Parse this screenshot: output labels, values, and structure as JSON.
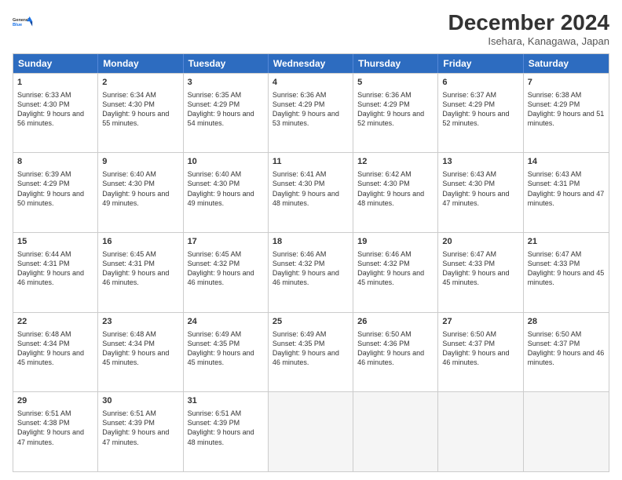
{
  "logo": {
    "line1": "General",
    "line2": "Blue",
    "icon_color": "#1a73e8"
  },
  "header": {
    "month": "December 2024",
    "location": "Isehara, Kanagawa, Japan"
  },
  "weekdays": [
    "Sunday",
    "Monday",
    "Tuesday",
    "Wednesday",
    "Thursday",
    "Friday",
    "Saturday"
  ],
  "weeks": [
    [
      {
        "day": "1",
        "sunrise": "Sunrise: 6:33 AM",
        "sunset": "Sunset: 4:30 PM",
        "daylight": "Daylight: 9 hours and 56 minutes."
      },
      {
        "day": "2",
        "sunrise": "Sunrise: 6:34 AM",
        "sunset": "Sunset: 4:30 PM",
        "daylight": "Daylight: 9 hours and 55 minutes."
      },
      {
        "day": "3",
        "sunrise": "Sunrise: 6:35 AM",
        "sunset": "Sunset: 4:29 PM",
        "daylight": "Daylight: 9 hours and 54 minutes."
      },
      {
        "day": "4",
        "sunrise": "Sunrise: 6:36 AM",
        "sunset": "Sunset: 4:29 PM",
        "daylight": "Daylight: 9 hours and 53 minutes."
      },
      {
        "day": "5",
        "sunrise": "Sunrise: 6:36 AM",
        "sunset": "Sunset: 4:29 PM",
        "daylight": "Daylight: 9 hours and 52 minutes."
      },
      {
        "day": "6",
        "sunrise": "Sunrise: 6:37 AM",
        "sunset": "Sunset: 4:29 PM",
        "daylight": "Daylight: 9 hours and 52 minutes."
      },
      {
        "day": "7",
        "sunrise": "Sunrise: 6:38 AM",
        "sunset": "Sunset: 4:29 PM",
        "daylight": "Daylight: 9 hours and 51 minutes."
      }
    ],
    [
      {
        "day": "8",
        "sunrise": "Sunrise: 6:39 AM",
        "sunset": "Sunset: 4:29 PM",
        "daylight": "Daylight: 9 hours and 50 minutes."
      },
      {
        "day": "9",
        "sunrise": "Sunrise: 6:40 AM",
        "sunset": "Sunset: 4:30 PM",
        "daylight": "Daylight: 9 hours and 49 minutes."
      },
      {
        "day": "10",
        "sunrise": "Sunrise: 6:40 AM",
        "sunset": "Sunset: 4:30 PM",
        "daylight": "Daylight: 9 hours and 49 minutes."
      },
      {
        "day": "11",
        "sunrise": "Sunrise: 6:41 AM",
        "sunset": "Sunset: 4:30 PM",
        "daylight": "Daylight: 9 hours and 48 minutes."
      },
      {
        "day": "12",
        "sunrise": "Sunrise: 6:42 AM",
        "sunset": "Sunset: 4:30 PM",
        "daylight": "Daylight: 9 hours and 48 minutes."
      },
      {
        "day": "13",
        "sunrise": "Sunrise: 6:43 AM",
        "sunset": "Sunset: 4:30 PM",
        "daylight": "Daylight: 9 hours and 47 minutes."
      },
      {
        "day": "14",
        "sunrise": "Sunrise: 6:43 AM",
        "sunset": "Sunset: 4:31 PM",
        "daylight": "Daylight: 9 hours and 47 minutes."
      }
    ],
    [
      {
        "day": "15",
        "sunrise": "Sunrise: 6:44 AM",
        "sunset": "Sunset: 4:31 PM",
        "daylight": "Daylight: 9 hours and 46 minutes."
      },
      {
        "day": "16",
        "sunrise": "Sunrise: 6:45 AM",
        "sunset": "Sunset: 4:31 PM",
        "daylight": "Daylight: 9 hours and 46 minutes."
      },
      {
        "day": "17",
        "sunrise": "Sunrise: 6:45 AM",
        "sunset": "Sunset: 4:32 PM",
        "daylight": "Daylight: 9 hours and 46 minutes."
      },
      {
        "day": "18",
        "sunrise": "Sunrise: 6:46 AM",
        "sunset": "Sunset: 4:32 PM",
        "daylight": "Daylight: 9 hours and 46 minutes."
      },
      {
        "day": "19",
        "sunrise": "Sunrise: 6:46 AM",
        "sunset": "Sunset: 4:32 PM",
        "daylight": "Daylight: 9 hours and 45 minutes."
      },
      {
        "day": "20",
        "sunrise": "Sunrise: 6:47 AM",
        "sunset": "Sunset: 4:33 PM",
        "daylight": "Daylight: 9 hours and 45 minutes."
      },
      {
        "day": "21",
        "sunrise": "Sunrise: 6:47 AM",
        "sunset": "Sunset: 4:33 PM",
        "daylight": "Daylight: 9 hours and 45 minutes."
      }
    ],
    [
      {
        "day": "22",
        "sunrise": "Sunrise: 6:48 AM",
        "sunset": "Sunset: 4:34 PM",
        "daylight": "Daylight: 9 hours and 45 minutes."
      },
      {
        "day": "23",
        "sunrise": "Sunrise: 6:48 AM",
        "sunset": "Sunset: 4:34 PM",
        "daylight": "Daylight: 9 hours and 45 minutes."
      },
      {
        "day": "24",
        "sunrise": "Sunrise: 6:49 AM",
        "sunset": "Sunset: 4:35 PM",
        "daylight": "Daylight: 9 hours and 45 minutes."
      },
      {
        "day": "25",
        "sunrise": "Sunrise: 6:49 AM",
        "sunset": "Sunset: 4:35 PM",
        "daylight": "Daylight: 9 hours and 46 minutes."
      },
      {
        "day": "26",
        "sunrise": "Sunrise: 6:50 AM",
        "sunset": "Sunset: 4:36 PM",
        "daylight": "Daylight: 9 hours and 46 minutes."
      },
      {
        "day": "27",
        "sunrise": "Sunrise: 6:50 AM",
        "sunset": "Sunset: 4:37 PM",
        "daylight": "Daylight: 9 hours and 46 minutes."
      },
      {
        "day": "28",
        "sunrise": "Sunrise: 6:50 AM",
        "sunset": "Sunset: 4:37 PM",
        "daylight": "Daylight: 9 hours and 46 minutes."
      }
    ],
    [
      {
        "day": "29",
        "sunrise": "Sunrise: 6:51 AM",
        "sunset": "Sunset: 4:38 PM",
        "daylight": "Daylight: 9 hours and 47 minutes."
      },
      {
        "day": "30",
        "sunrise": "Sunrise: 6:51 AM",
        "sunset": "Sunset: 4:39 PM",
        "daylight": "Daylight: 9 hours and 47 minutes."
      },
      {
        "day": "31",
        "sunrise": "Sunrise: 6:51 AM",
        "sunset": "Sunset: 4:39 PM",
        "daylight": "Daylight: 9 hours and 48 minutes."
      },
      {
        "day": "",
        "sunrise": "",
        "sunset": "",
        "daylight": ""
      },
      {
        "day": "",
        "sunrise": "",
        "sunset": "",
        "daylight": ""
      },
      {
        "day": "",
        "sunrise": "",
        "sunset": "",
        "daylight": ""
      },
      {
        "day": "",
        "sunrise": "",
        "sunset": "",
        "daylight": ""
      }
    ]
  ]
}
